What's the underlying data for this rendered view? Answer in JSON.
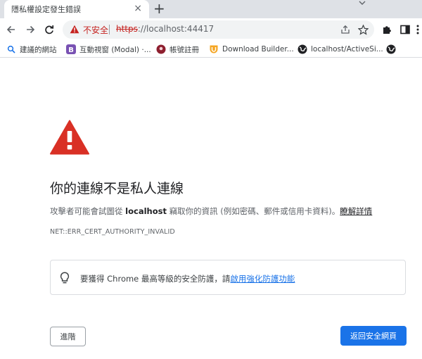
{
  "tab": {
    "title": "隱私權設定發生錯誤",
    "close": "×",
    "new_tab": "+"
  },
  "toolbar": {
    "insecure_label": "不安全",
    "url_scheme": "https",
    "url_rest": "://localhost:44417"
  },
  "bookmarks": [
    {
      "label": "建議的網站",
      "icon": "search-icon"
    },
    {
      "label": "互動視窗 (Modal) ·...",
      "icon": "bootstrap-icon"
    },
    {
      "label": "帳號註冊",
      "icon": "site-icon"
    },
    {
      "label": "Download Builder...",
      "icon": "download-builder-icon"
    },
    {
      "label": "localhost/ActiveSi...",
      "icon": "globe-icon"
    },
    {
      "label": "",
      "icon": "globe-icon"
    }
  ],
  "page": {
    "heading": "你的連線不是私人連線",
    "desc_before": "攻擊者可能會試圖從 ",
    "desc_host": "localhost",
    "desc_after": " 竊取你的資訊 (例如密碼、郵件或信用卡資料)。",
    "desc_link": "瞭解詳情",
    "error_code": "NET::ERR_CERT_AUTHORITY_INVALID",
    "tip_text": "要獲得 Chrome 最高等級的安全防護，請",
    "tip_link": "啟用強化防護功能",
    "advanced_button": "進階",
    "back_button": "返回安全網頁"
  },
  "colors": {
    "warning_red": "#d93025",
    "link_blue": "#1a73e8",
    "tab_strip": "#dee1e6"
  }
}
